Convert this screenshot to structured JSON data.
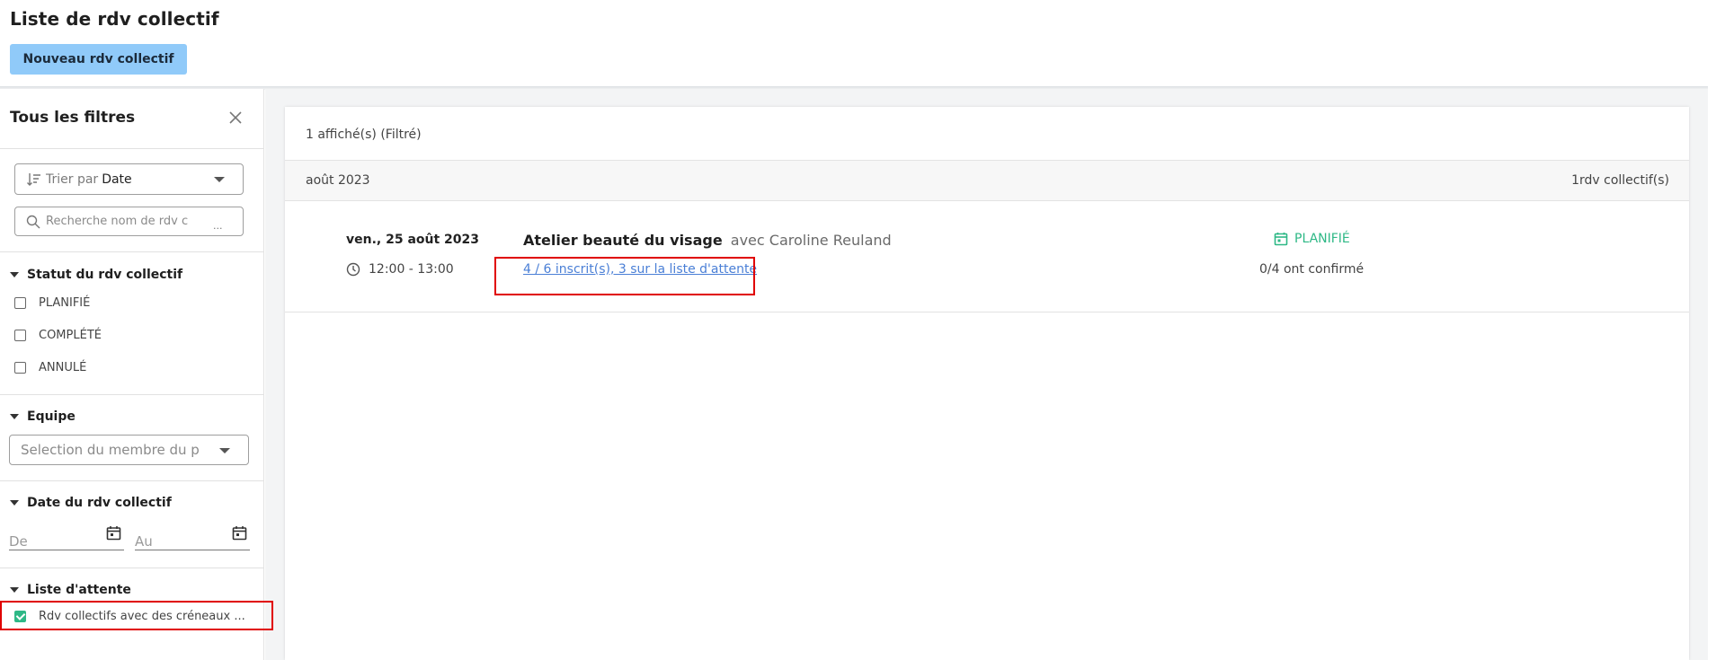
{
  "header": {
    "title": "Liste de rdv collectif",
    "new_button_label": "Nouveau rdv collectif"
  },
  "sidebar": {
    "title": "Tous les filtres",
    "sort": {
      "prefix": "Trier par",
      "value": "Date"
    },
    "search": {
      "placeholder": "Recherche nom de rdv c",
      "ellipsis": "..."
    },
    "status_section": {
      "title": "Statut du rdv collectif",
      "options": [
        {
          "label": "PLANIFIÉ",
          "checked": false
        },
        {
          "label": "COMPLÉTÉ",
          "checked": false
        },
        {
          "label": "ANNULÉ",
          "checked": false
        }
      ]
    },
    "team_section": {
      "title": "Equipe",
      "placeholder": "Selection du membre du p"
    },
    "date_section": {
      "title": "Date du rdv collectif",
      "from_placeholder": "De",
      "to_placeholder": "Au"
    },
    "waitlist_section": {
      "title": "Liste d'attente",
      "option_label": "Rdv collectifs avec des créneaux ...",
      "checked": true
    }
  },
  "main": {
    "count_label": "1 affiché(s) (Filtré)",
    "month": {
      "label": "août 2023",
      "count": "1rdv collectif(s)"
    },
    "events": [
      {
        "date": "ven., 25 août 2023",
        "time": "12:00 - 13:00",
        "title": "Atelier beauté du visage",
        "with": "avec Caroline Reuland",
        "registrations": "4 / 6 inscrit(s), 3 sur la liste d'attente",
        "status": "PLANIFIÉ",
        "confirmed": "0/4 ont confirmé"
      }
    ]
  },
  "colors": {
    "primary_button": "#90caf9",
    "status_green": "#2eb886",
    "link_blue": "#4a7fd6",
    "highlight_red": "#e00000"
  }
}
